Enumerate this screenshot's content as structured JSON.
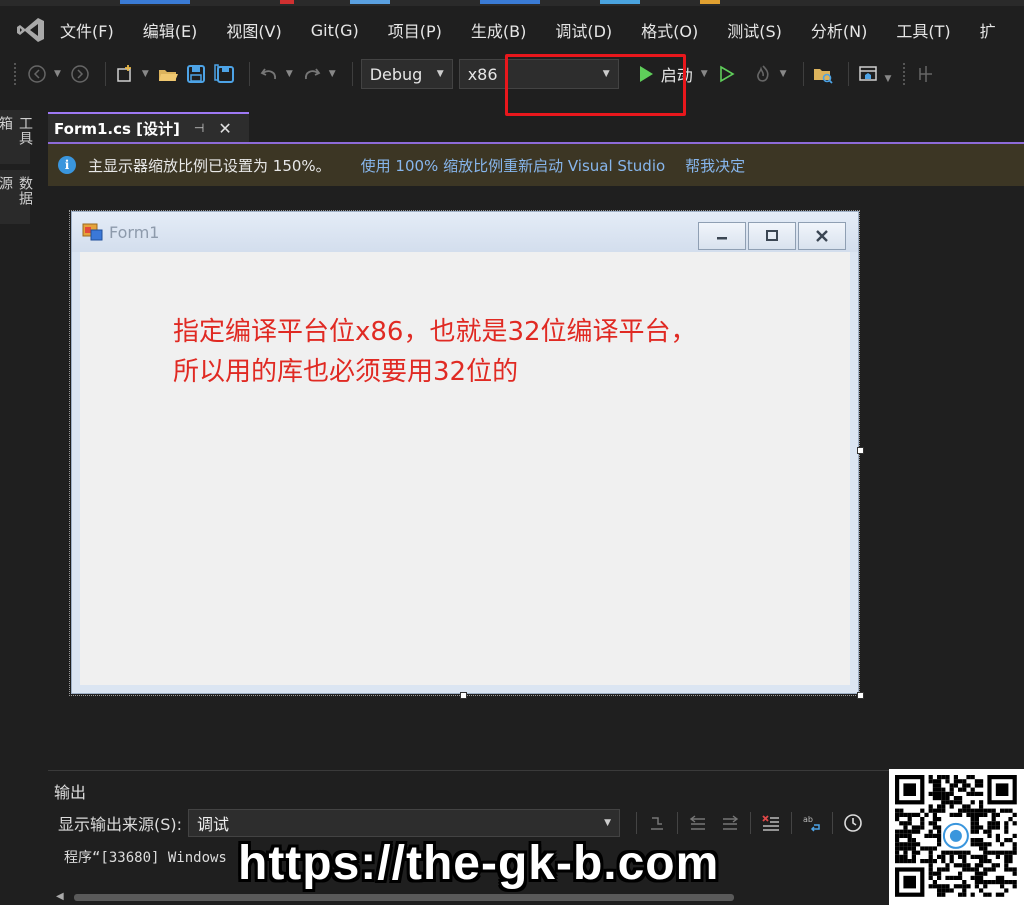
{
  "menu": {
    "items": [
      "文件(F)",
      "编辑(E)",
      "视图(V)",
      "Git(G)",
      "项目(P)",
      "生成(B)",
      "调试(D)",
      "格式(O)",
      "测试(S)",
      "分析(N)",
      "工具(T)",
      "扩"
    ]
  },
  "toolbar": {
    "configuration": "Debug",
    "platform": "x86",
    "start_label": "启动",
    "icons": [
      "back-icon",
      "forward-icon",
      "new-project-icon",
      "open-folder-icon",
      "save-icon",
      "save-all-icon",
      "undo-icon",
      "redo-icon",
      "play-icon",
      "play-outline-icon",
      "hot-reload-icon",
      "explorer-icon",
      "window-layout-icon"
    ]
  },
  "side_tabs": [
    "工具箱",
    "数据源"
  ],
  "doc_tab": {
    "label": "Form1.cs [设计]"
  },
  "infobar": {
    "message": "主显示器缩放比例已设置为 150%。",
    "link_restart": "使用 100% 缩放比例重新启动 Visual Studio",
    "link_decide": "帮我决定"
  },
  "form": {
    "title": "Form1",
    "annotation_line1": "指定编译平台位x86，也就是32位编译平台，",
    "annotation_line2": "所以用的库也必须要用32位的"
  },
  "output": {
    "title": "输出",
    "source_label": "显示输出来源(S):",
    "source_value": "调试",
    "text": "程序“[33680] Windows"
  },
  "watermark": "https://the-gk-b.com",
  "colors": {
    "accent": "#9e79f5",
    "highlight": "#e8171c",
    "annotation": "#e02a23",
    "infobar": "#3c3624",
    "link": "#87b6ec"
  }
}
